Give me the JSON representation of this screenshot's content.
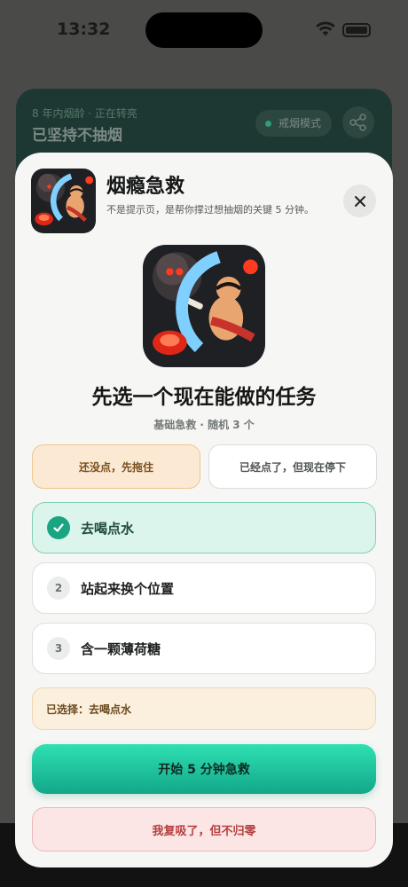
{
  "status_bar": {
    "time": "13:32"
  },
  "background_card": {
    "subtitle": "8 年内烟龄 · 正在转亮",
    "title": "已坚持不抽烟",
    "mode_pill": "戒烟模式"
  },
  "sheet": {
    "title": "烟瘾急救",
    "description": "不是提示页，是帮你撑过想抽烟的关键 5 分钟。",
    "main_title": "先选一个现在能做的任务",
    "subline": "基础急救 · 随机 3 个",
    "mode_options": [
      "还没点，先拖住",
      "已经点了，但现在停下"
    ],
    "tasks": [
      {
        "num": "✓",
        "label": "去喝点水",
        "selected": true
      },
      {
        "num": "2",
        "label": "站起来换个位置",
        "selected": false
      },
      {
        "num": "3",
        "label": "含一颗薄荷糖",
        "selected": false
      }
    ],
    "selected_text": "已选择：去喝点水",
    "start_button": "开始 5 分钟急救",
    "relapse_button": "我复吸了，但不归零"
  },
  "icons": [
    "app-illustration-icon",
    "close-icon",
    "check-icon",
    "share-icon",
    "wifi-icon",
    "battery-icon"
  ],
  "colors": {
    "accent": "#1aa581",
    "warning_bg": "#fbe9d4",
    "danger": "#b64040"
  }
}
